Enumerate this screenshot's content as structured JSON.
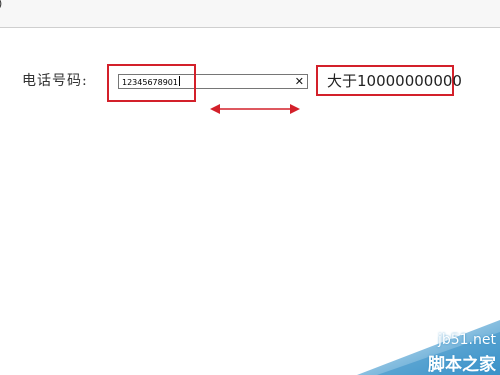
{
  "topbar": {
    "glyph": ")"
  },
  "form": {
    "phone_label": "电话号码:",
    "phone_value": "12345678901",
    "clear_symbol": "✕"
  },
  "annotation": {
    "result_text": "大于10000000000",
    "highlight_color": "#d3202a",
    "arrow_color": "#d3202a"
  },
  "watermark": {
    "url": "jb51.net",
    "name": "脚本之家",
    "colors": [
      "#3a92c8",
      "#d7ecf8"
    ]
  }
}
